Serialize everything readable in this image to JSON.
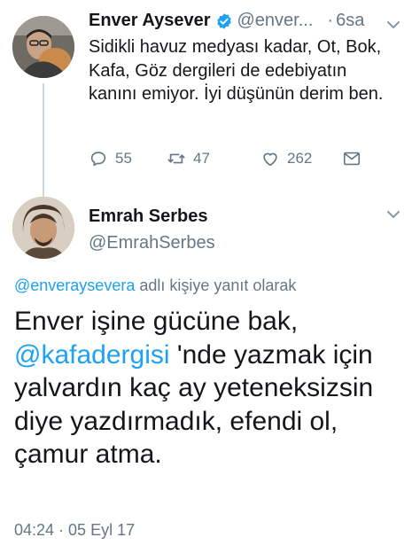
{
  "thread": {
    "parent_tweet": {
      "name": "Enver Aysever",
      "handle": "@enver...",
      "time_separator": "·",
      "time": "6sa",
      "verified": true,
      "text": "Sidikli havuz medyası kadar, Ot, Bok, Kafa, Göz dergileri de edebiyatın kanını emiyor. İyi düşünün derim ben.",
      "actions": {
        "reply_count": "55",
        "retweet_count": "47",
        "like_count": "262"
      }
    },
    "reply_tweet": {
      "name": "Emrah Serbes",
      "handle": "@EmrahSerbes",
      "replying_to": {
        "mention": "@enveraysevera",
        "suffix": " adlı kişiye yanıt olarak"
      },
      "text_part1": "Enver işine gücüne bak, ",
      "text_mention": "@kafadergisi",
      "text_part2": " 'nde yazmak için yalvardın kaç ay yeteneksizsin diye yazdırmadık, efendi ol, çamur atma.",
      "timestamp": "04:24 · 05 Eyl 17"
    }
  },
  "colors": {
    "text": "#14171a",
    "secondary": "#657786",
    "link": "#1da1f2",
    "thread_line": "#ccd6dd"
  },
  "icons": {
    "verified": "verified-badge-icon",
    "reply": "reply-icon",
    "retweet": "retweet-icon",
    "like": "heart-icon",
    "dm": "envelope-icon",
    "caret": "chevron-down-icon"
  }
}
